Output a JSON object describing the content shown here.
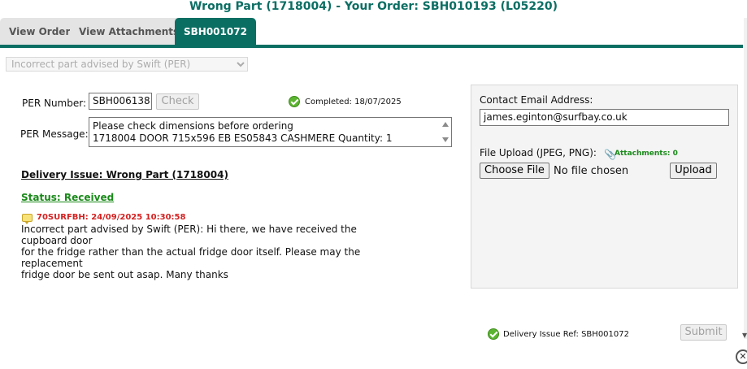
{
  "dialog": {
    "title": "Wrong Part (1718004) - Your Order: SBH010193 (L05220)"
  },
  "tabs": [
    {
      "label": "View Order"
    },
    {
      "label": "View Attachments"
    },
    {
      "label": "SBH001072"
    }
  ],
  "form": {
    "reason_select": {
      "value": "Incorrect part advised by Swift (PER)"
    },
    "per_number": {
      "label": "PER Number:",
      "value": "SBH006138",
      "check_label": "Check"
    },
    "completed": {
      "text": "Completed: 18/07/2025"
    },
    "per_message": {
      "label": "PER Message:",
      "line1": "Please check dimensions before ordering",
      "line2": "1718004 DOOR 715x596 EB ES05843 CASHMERE Quantity: 1"
    }
  },
  "issue": {
    "heading": "Delivery Issue: Wrong Part (1718004)",
    "status": "Status: Received",
    "comment": {
      "author": "70SURFBH: 24/09/2025 10:30:58",
      "line1": "Incorrect part advised by Swift (PER): Hi there, we have received the cupboard door",
      "line2": "for the fridge rather than the actual fridge door itself. Please may the replacement",
      "line3": "fridge door be sent out asap. Many thanks"
    }
  },
  "contact": {
    "email_label": "Contact Email Address:",
    "email_value": "james.eginton@surfbay.co.uk",
    "upload_label": "File Upload (JPEG, PNG):",
    "attachments": "Attachments: 0",
    "choose_file": "Choose File",
    "no_file": "No file chosen",
    "upload_button": "Upload"
  },
  "footer": {
    "ref_text": "Delivery Issue Ref: SBH001072",
    "submit_label": "Submit"
  },
  "icons": {
    "check": "check-circle-icon",
    "comment": "comment-icon",
    "paperclip": "paperclip-icon",
    "close": "close-icon"
  },
  "colors": {
    "accent": "#0b6e63",
    "success": "#1a8a1a",
    "comment_author": "#d42121"
  }
}
